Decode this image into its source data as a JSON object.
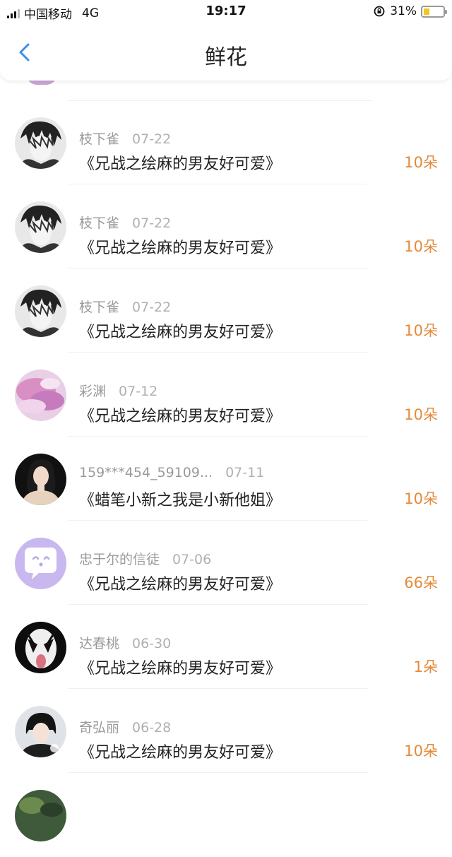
{
  "status_bar": {
    "carrier": "中国移动",
    "network": "4G",
    "time": "19:17",
    "battery_percent": "31%",
    "battery_level": 0.31
  },
  "nav": {
    "title": "鲜花"
  },
  "rows": [
    {
      "name": "枝下雀",
      "date": "07-22",
      "book": "《兄战之绘麻的男友好可爱》",
      "count": "10朵"
    },
    {
      "name": "枝下雀",
      "date": "07-22",
      "book": "《兄战之绘麻的男友好可爱》",
      "count": "10朵"
    },
    {
      "name": "枝下雀",
      "date": "07-22",
      "book": "《兄战之绘麻的男友好可爱》",
      "count": "10朵"
    },
    {
      "name": "彩渊",
      "date": "07-12",
      "book": "《兄战之绘麻的男友好可爱》",
      "count": "10朵"
    },
    {
      "name": "159***454_59109...",
      "date": "07-11",
      "book": "《蜡笔小新之我是小新他姐》",
      "count": "10朵"
    },
    {
      "name": "忠于尔的信徒",
      "date": "07-06",
      "book": "《兄战之绘麻的男友好可爱》",
      "count": "66朵"
    },
    {
      "name": "达春桃",
      "date": "06-30",
      "book": "《兄战之绘麻的男友好可爱》",
      "count": "1朵"
    },
    {
      "name": "奇弘丽",
      "date": "06-28",
      "book": "《兄战之绘麻的男友好可爱》",
      "count": "10朵"
    }
  ],
  "colors": {
    "count": "#e48a3a",
    "accent": "#3d8fe8",
    "battery": "#f5c518"
  }
}
